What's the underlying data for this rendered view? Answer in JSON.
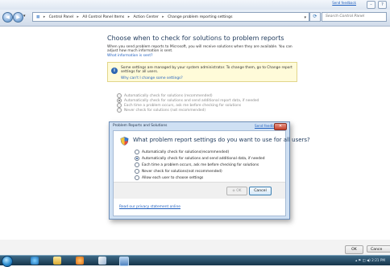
{
  "window": {
    "feedback_link": "Send feedback",
    "breadcrumb": [
      "Control Panel",
      "All Control Panel Items",
      "Action Center",
      "Change problem reporting settings"
    ],
    "search_placeholder": "Search Control Panel"
  },
  "main": {
    "title": "Choose when to check for solutions to problem reports",
    "description": "When you send problem reports to Microsoft, you will receive solutions when they are available. You can adjust how much information is sent.",
    "info_link": "What information is sent?",
    "admin_notice": "Some settings are managed by your system administrator. To change them, go to Change report settings for all users.",
    "admin_link": "Why can't I change some settings?",
    "options": [
      {
        "label": "Automatically check for solutions (recommended)",
        "selected": false
      },
      {
        "label": "Automatically check for solutions and send additional report data, if needed",
        "selected": true
      },
      {
        "label": "Each time a problem occurs, ask me before checking for solutions",
        "selected": false
      },
      {
        "label": "Never check for solutions (not recommended)",
        "selected": false
      }
    ],
    "ok_label": "OK",
    "cancel_label": "Cance"
  },
  "dialog": {
    "title": "Problem Reports and Solutions",
    "feedback_link": "Send feedback",
    "close_glyph": "✕",
    "question": "What problem report settings do you want to use for all users?",
    "options": [
      {
        "label": "Automatically check for solutions(recommended)",
        "selected": false
      },
      {
        "label": "Automatically check for solutions and send additional data, if needed",
        "selected": true
      },
      {
        "label": "Each time a problem occurs, ask me before checking for solutions",
        "selected": false
      },
      {
        "label": "Never check for solutions(not recommended)",
        "selected": false
      },
      {
        "label": "Allow each user to choose settings",
        "selected": false
      }
    ],
    "ok_label": "OK",
    "cancel_label": "Cancel",
    "privacy_link": "Read our privacy statement online"
  },
  "taskbar": {
    "clock": "2:21 PM",
    "icons": [
      "ie-icon",
      "folder-icon",
      "media-player-icon",
      "paint-icon",
      "control-panel-icon"
    ]
  }
}
